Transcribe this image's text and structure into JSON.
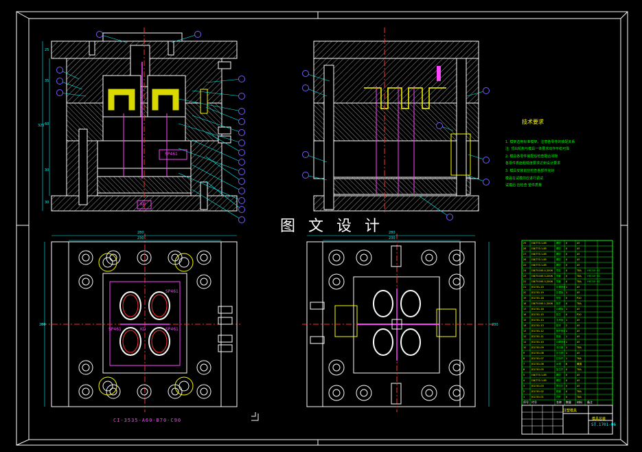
{
  "watermark": "图 文 设 计",
  "technical_requirements": {
    "title": "技术要求",
    "lines": [
      "1. 模架选用标准模架，注意各零件的装配关系",
      "注: 顶出机构与模具一体要求动作平稳可靠",
      "2. 模具各零件装配后检查配合间隙",
      "各零件表面粗糙度要求达到设计要求",
      "3. 模具安装前应检查各部件完好",
      "模具在试模前应进行调试",
      "试模后 应检查 塑件质量"
    ]
  },
  "mold_code": "CI-3535-A60-B70-C90",
  "drawing_number": "ST.1701-06",
  "drawing_title": "模具总装",
  "title_block_name": "注塑模具",
  "cavity_marks": {
    "left_sp1": "SP461",
    "left_sp2": "SP461",
    "left_sp3": "SP461",
    "left_kd": "KD",
    "top_kd": "KD",
    "top_sp": "SP461"
  },
  "dimensions": {
    "plan_left_outer": "280",
    "plan_left_inner": "230",
    "plan_right_outer": "280",
    "plan_right_inner": "230",
    "plan_left_height": "280",
    "plan_right_height": "230",
    "section_height": "325",
    "section_a": "25",
    "section_b": "35",
    "section_c": "60",
    "section_d": "30",
    "section_e": "30"
  },
  "colors": {
    "background": "#000000",
    "border": "#ffffff",
    "outline": "#ffffff",
    "hatch": "#bbbbbb",
    "centerline": "#ff3030",
    "leader": "#00ffff",
    "balloon": "#7a5cff",
    "table": "#00ff00",
    "pink": "#ff44ff"
  },
  "bom_rows": [
    [
      "29",
      "GB/T70.1-85",
      "螺钉",
      "4",
      "45",
      ""
    ],
    [
      "28",
      "GB/T70.1-85",
      "螺钉",
      "4",
      "45",
      ""
    ],
    [
      "27",
      "GB/T70.1-85",
      "螺钉",
      "4",
      "45",
      ""
    ],
    [
      "26",
      "GB/T70.1-85",
      "螺钉",
      "4",
      "45",
      ""
    ],
    [
      "25",
      "GB/T70.1-85",
      "螺钉",
      "4",
      "45",
      ""
    ],
    [
      "24",
      "GB/T4169.4-2006",
      "导柱",
      "4",
      "T8A",
      "HRC58~62"
    ],
    [
      "23",
      "GB/T4169.3-2006",
      "导套",
      "4",
      "T8A",
      "HRC58~62"
    ],
    [
      "22",
      "GB/T4169.3-2006",
      "导套",
      "4",
      "T8A",
      "HRC58~62"
    ],
    [
      "21",
      "JS1701-20",
      "定模座板",
      "1",
      "45",
      ""
    ],
    [
      "20",
      "JS1701-19",
      "定模板",
      "1",
      "45",
      ""
    ],
    [
      "19",
      "JS1701-18",
      "型腔",
      "4",
      "P20",
      ""
    ],
    [
      "18",
      "GB/T4169.1-2006",
      "推杆",
      "4",
      "T8A",
      ""
    ],
    [
      "17",
      "JS1701-16",
      "动模板",
      "1",
      "45",
      ""
    ],
    [
      "16",
      "JS1701-15",
      "型芯",
      "4",
      "P20",
      ""
    ],
    [
      "15",
      "JS1701-14",
      "支承板",
      "1",
      "45",
      ""
    ],
    [
      "14",
      "JS1701-13",
      "垫块",
      "2",
      "45",
      ""
    ],
    [
      "13",
      "JS1701-12",
      "推杆固定板",
      "1",
      "45",
      ""
    ],
    [
      "12",
      "JS1701-11",
      "推板",
      "1",
      "45",
      ""
    ],
    [
      "11",
      "JS1701-10",
      "动模座板",
      "1",
      "45",
      ""
    ],
    [
      "10",
      "JS1701-09",
      "浇口套",
      "1",
      "T8A",
      ""
    ],
    [
      "9",
      "JS1701-08",
      "定位圈",
      "1",
      "45",
      ""
    ],
    [
      "8",
      "JS1701-07",
      "拉料杆",
      "1",
      "T8A",
      ""
    ],
    [
      "7",
      "JS1701-06",
      "水嘴",
      "8",
      "黄铜",
      ""
    ],
    [
      "6",
      "JS1701-05",
      "复位杆",
      "4",
      "T8A",
      ""
    ],
    [
      "5",
      "GB/T70.1-85",
      "螺钉",
      "4",
      "45",
      ""
    ],
    [
      "4",
      "GB/T70.1-85",
      "螺钉",
      "4",
      "45",
      ""
    ],
    [
      "3",
      "JS1701-03",
      "限位钉",
      "4",
      "45",
      ""
    ],
    [
      "2",
      "JS1701-02",
      "推管",
      "4",
      "T8A",
      ""
    ],
    [
      "1",
      "JS1701-01",
      "顶杆",
      "4",
      "T8A",
      ""
    ]
  ],
  "bom_header": [
    "序号",
    "代号",
    "名称",
    "数量",
    "材料",
    "备注"
  ],
  "balloons_left": [
    "1",
    "2",
    "3",
    "4",
    "5",
    "6",
    "7",
    "8",
    "9",
    "10",
    "11",
    "12",
    "13",
    "14",
    "15",
    "16",
    "17",
    "18",
    "19",
    "20",
    "21",
    "22",
    "23",
    "24",
    "25"
  ],
  "balloons_right": [
    "26",
    "27",
    "28",
    "29",
    "30",
    "31",
    "32",
    "33",
    "34"
  ]
}
